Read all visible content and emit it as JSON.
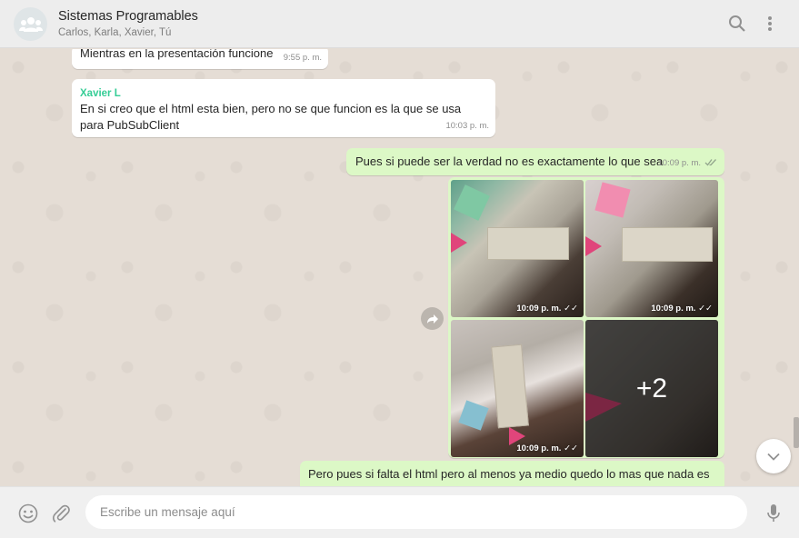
{
  "header": {
    "title": "Sistemas Programables",
    "participants": "Carlos, Karla, Xavier, Tú",
    "icons": [
      "group-avatar-icon",
      "search-icon",
      "menu-dots-icon"
    ]
  },
  "messages": [
    {
      "direction": "in",
      "text": "Mientras en la presentación funcione",
      "time": "9:55 p. m."
    },
    {
      "direction": "in",
      "sender": "Xavier L",
      "text": "En si creo que el html esta bien, pero no se que funcion es la que se usa para PubSubClient",
      "time": "10:03 p. m."
    },
    {
      "direction": "out",
      "text": "Pues si puede ser la verdad no es exactamente lo que sea",
      "time": "10:09 p. m."
    },
    {
      "direction": "out",
      "type": "album",
      "photos": [
        {
          "time": "10:09 p. m."
        },
        {
          "time": "10:09 p. m."
        },
        {
          "time": "10:09 p. m."
        },
        {
          "more": "+2"
        }
      ]
    },
    {
      "direction": "out",
      "text": "Pero pues si falta el html pero al menos ya medio quedo lo mas que nada es"
    }
  ],
  "composer": {
    "placeholder": "Escribe un mensaje aquí"
  },
  "colors": {
    "incoming": "#ffffff",
    "outgoing": "#dcf8c6",
    "sender_name": "#35cd96",
    "background": "#e5ddd5"
  }
}
